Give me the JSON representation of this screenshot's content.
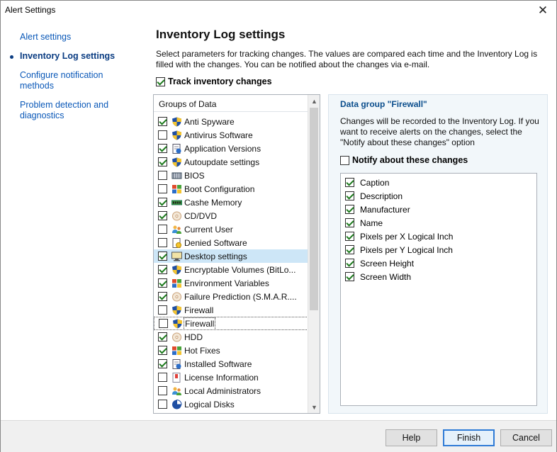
{
  "window": {
    "title": "Alert Settings"
  },
  "nav": {
    "items": [
      {
        "label": "Alert settings",
        "active": false
      },
      {
        "label": "Inventory Log settings",
        "active": true
      },
      {
        "label": "Configure notification methods",
        "active": false
      },
      {
        "label": "Problem detection and diagnostics",
        "active": false
      }
    ]
  },
  "main": {
    "heading": "Inventory Log settings",
    "description": "Select parameters for tracking changes. The values are compared each time and the Inventory Log is filled with the changes. You can be notified about the changes via e-mail.",
    "track_label": "Track inventory changes",
    "track_checked": true
  },
  "groups": {
    "header": "Groups of Data",
    "items": [
      {
        "label": "Anti Spyware",
        "checked": true,
        "icon": "shield-icon"
      },
      {
        "label": "Antivirus Software",
        "checked": false,
        "icon": "shield-icon"
      },
      {
        "label": "Application Versions",
        "checked": true,
        "icon": "app-versions-icon"
      },
      {
        "label": "Autoupdate settings",
        "checked": true,
        "icon": "shield-icon"
      },
      {
        "label": "BIOS",
        "checked": false,
        "icon": "chip-icon"
      },
      {
        "label": "Boot Configuration",
        "checked": false,
        "icon": "windows-icon"
      },
      {
        "label": "Cashe Memory",
        "checked": true,
        "icon": "memory-icon"
      },
      {
        "label": "CD/DVD",
        "checked": true,
        "icon": "disc-icon"
      },
      {
        "label": "Current User",
        "checked": false,
        "icon": "users-icon"
      },
      {
        "label": "Denied Software",
        "checked": false,
        "icon": "denied-software-icon"
      },
      {
        "label": "Desktop settings",
        "checked": true,
        "icon": "monitor-icon",
        "selected": true
      },
      {
        "label": "Encryptable Volumes (BitLo...",
        "checked": true,
        "icon": "shield-icon"
      },
      {
        "label": "Environment Variables",
        "checked": true,
        "icon": "windows-icon"
      },
      {
        "label": "Failure Prediction (S.M.A.R....",
        "checked": true,
        "icon": "disc-icon"
      },
      {
        "label": "Firewall",
        "checked": false,
        "icon": "shield-icon"
      },
      {
        "label": "Firewall",
        "checked": false,
        "icon": "shield-icon",
        "focused": true
      },
      {
        "label": "HDD",
        "checked": true,
        "icon": "disc-icon"
      },
      {
        "label": "Hot Fixes",
        "checked": true,
        "icon": "windows-icon"
      },
      {
        "label": "Installed Software",
        "checked": true,
        "icon": "app-versions-icon"
      },
      {
        "label": "License Information",
        "checked": false,
        "icon": "license-icon"
      },
      {
        "label": "Local Administrators",
        "checked": false,
        "icon": "users-icon"
      },
      {
        "label": "Logical Disks",
        "checked": false,
        "icon": "pie-icon"
      }
    ]
  },
  "detail": {
    "title": "Data group \"Firewall\"",
    "text": "Changes will be recorded to the Inventory Log. If you want to receive alerts on the changes, select the \"Notify about these changes\" option",
    "notify_label": "Notify about these changes",
    "notify_checked": false,
    "fields": [
      {
        "label": "Caption",
        "checked": true
      },
      {
        "label": "Description",
        "checked": true
      },
      {
        "label": "Manufacturer",
        "checked": true
      },
      {
        "label": "Name",
        "checked": true
      },
      {
        "label": "Pixels per X Logical Inch",
        "checked": true
      },
      {
        "label": "Pixels per Y Logical Inch",
        "checked": true
      },
      {
        "label": "Screen Height",
        "checked": true
      },
      {
        "label": "Screen Width",
        "checked": true
      }
    ]
  },
  "footer": {
    "help_label": "Help",
    "finish_label": "Finish",
    "cancel_label": "Cancel"
  }
}
